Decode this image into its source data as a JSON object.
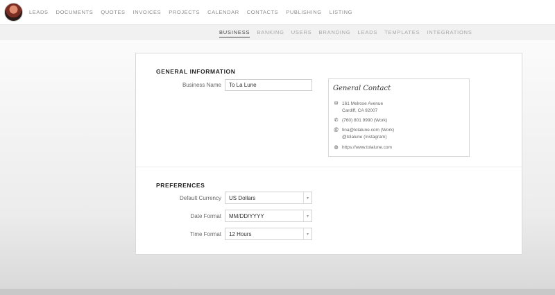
{
  "main_nav": {
    "items": [
      "LEADS",
      "DOCUMENTS",
      "QUOTES",
      "INVOICES",
      "PROJECTS",
      "CALENDAR",
      "CONTACTS",
      "PUBLISHING",
      "LISTING"
    ]
  },
  "settings_tabs": {
    "items": [
      "BUSINESS",
      "BANKING",
      "USERS",
      "BRANDING",
      "LEADS",
      "TEMPLATES",
      "INTEGRATIONS"
    ],
    "active": "BUSINESS"
  },
  "general": {
    "section_title": "GENERAL INFORMATION",
    "business_name_label": "Business Name",
    "business_name_value": "To La Lune"
  },
  "contact": {
    "title": "General Contact",
    "address_line1": "161 Melrose Avenue",
    "address_line2": "Cardiff, CA 92007",
    "phone": "(760) 801 9990 (Work)",
    "email": "tina@tolalune.com (Work)",
    "instagram": "@tolalune (Instagram)",
    "website": "https://www.tolalune.com"
  },
  "preferences": {
    "section_title": "PREFERENCES",
    "currency_label": "Default Currency",
    "currency_value": "US Dollars",
    "date_label": "Date Format",
    "date_value": "MM/DD/YYYY",
    "time_label": "Time Format",
    "time_value": "12 Hours"
  },
  "icons": {
    "address": "envelope-icon",
    "phone": "phone-icon",
    "email": "at-icon",
    "website": "globe-icon",
    "dropdown": "chevron-down-icon"
  }
}
